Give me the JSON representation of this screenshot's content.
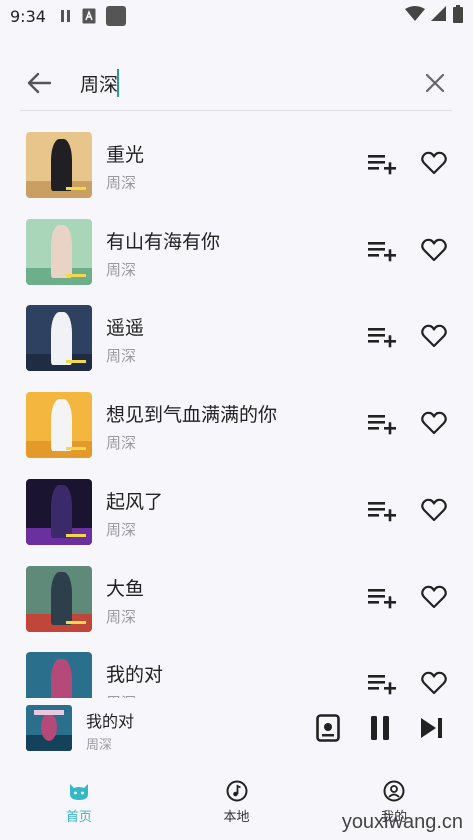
{
  "status_bar": {
    "time": "9:34"
  },
  "search": {
    "query": "周深"
  },
  "songs": [
    {
      "title": "重光",
      "artist": "周深",
      "cover_bg": "#e8c58a",
      "cover_band": "#c9a062",
      "cover_figure": "#1f1f24"
    },
    {
      "title": "有山有海有你",
      "artist": "周深",
      "cover_bg": "#a9d6b8",
      "cover_band": "#6fae8a",
      "cover_figure": "#e9d3c7"
    },
    {
      "title": "遥遥",
      "artist": "周深",
      "cover_bg": "#2f4160",
      "cover_band": "#1f2c44",
      "cover_figure": "#f0f2f5"
    },
    {
      "title": "想见到气血满满的你",
      "artist": "周深",
      "cover_bg": "#f3b63e",
      "cover_band": "#e39a2a",
      "cover_figure": "#f4f4f4"
    },
    {
      "title": "起风了",
      "artist": "周深",
      "cover_bg": "#1b1430",
      "cover_band": "#6b2fa0",
      "cover_figure": "#3a2a6a"
    },
    {
      "title": "大鱼",
      "artist": "周深",
      "cover_bg": "#5f8a7a",
      "cover_band": "#c0463a",
      "cover_figure": "#2c3f4a"
    },
    {
      "title": "我的对",
      "artist": "周深",
      "cover_bg": "#2a6f8c",
      "cover_band": "#14425a",
      "cover_figure": "#b54a7a"
    }
  ],
  "player": {
    "title": "我的对",
    "artist": "周深"
  },
  "nav": [
    {
      "label": "首页",
      "active": true
    },
    {
      "label": "本地",
      "active": false
    },
    {
      "label": "我的",
      "active": false
    }
  ],
  "watermark": "youxiwang.cn",
  "colors": {
    "accent": "#34b7c7",
    "cursor": "#2a9d8f"
  }
}
